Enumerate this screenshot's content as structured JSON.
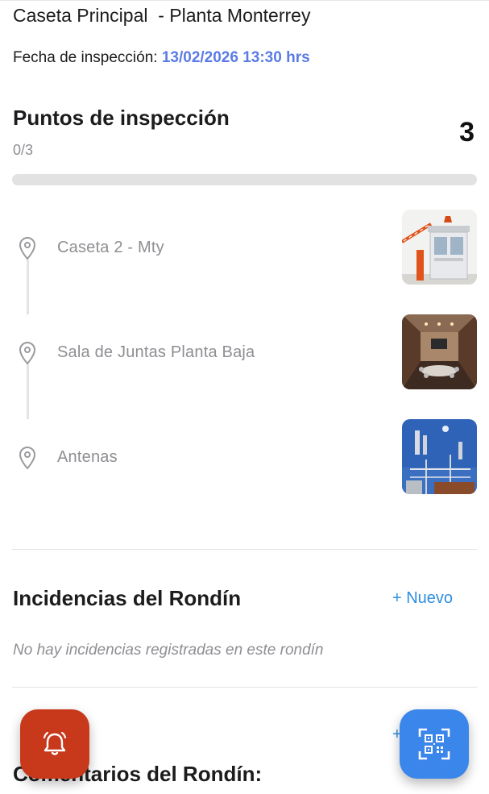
{
  "header": {
    "title": "Caseta Principal  - Planta Monterrey",
    "date_label": "Fecha de inspección: ",
    "date_value": "13/02/2026 13:30 hrs"
  },
  "inspection": {
    "heading": "Puntos de inspección",
    "progress_text": "0/3",
    "total": "3",
    "progress_fraction": 0,
    "points": [
      {
        "label": "Caseta 2 - Mty",
        "image": "guard-booth-photo"
      },
      {
        "label": "Sala de Juntas Planta Baja",
        "image": "meeting-room-photo"
      },
      {
        "label": "Antenas",
        "image": "antennas-photo"
      }
    ]
  },
  "incidents": {
    "heading": "Incidencias del Rondín",
    "new_label": "+ Nuevo",
    "empty_text": "No hay incidencias registradas en este rondín"
  },
  "comments": {
    "heading": "Comentarios del Rondín:",
    "add_label": "+"
  },
  "fabs": {
    "alert_icon": "alarm-bell-icon",
    "qr_icon": "qr-scan-icon"
  },
  "colors": {
    "accent": "#5b7be6",
    "link": "#2f8ee0",
    "alert": "#c8381a",
    "qr_button": "#3b86ea"
  }
}
